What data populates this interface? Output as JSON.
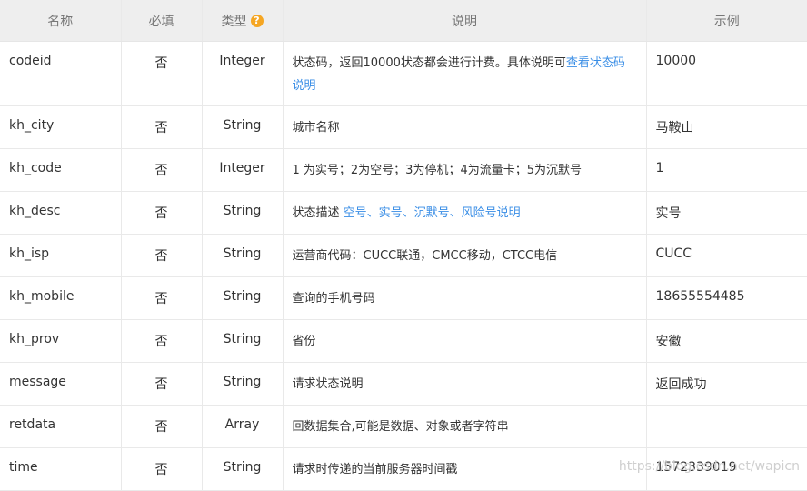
{
  "header": {
    "name": "名称",
    "required": "必填",
    "type": "类型",
    "help_icon": "?",
    "description": "说明",
    "example": "示例"
  },
  "rows": [
    {
      "name": "codeid",
      "required": "否",
      "type": "Integer",
      "desc_text": "状态码，返回10000状态都会进行计费。具体说明可",
      "desc_link": "查看状态码说明",
      "example": "10000"
    },
    {
      "name": "kh_city",
      "required": "否",
      "type": "String",
      "desc_text": "城市名称",
      "desc_link": "",
      "example": "马鞍山"
    },
    {
      "name": "kh_code",
      "required": "否",
      "type": "Integer",
      "desc_text": "1 为实号；2为空号；3为停机；4为流量卡；5为沉默号",
      "desc_link": "",
      "example": "1"
    },
    {
      "name": "kh_desc",
      "required": "否",
      "type": "String",
      "desc_text": "状态描述 ",
      "desc_link": "空号、实号、沉默号、风险号说明",
      "example": "实号"
    },
    {
      "name": "kh_isp",
      "required": "否",
      "type": "String",
      "desc_text": "运营商代码：CUCC联通，CMCC移动，CTCC电信",
      "desc_link": "",
      "example": "CUCC"
    },
    {
      "name": "kh_mobile",
      "required": "否",
      "type": "String",
      "desc_text": "查询的手机号码",
      "desc_link": "",
      "example": "18655554485"
    },
    {
      "name": "kh_prov",
      "required": "否",
      "type": "String",
      "desc_text": "省份",
      "desc_link": "",
      "example": "安徽"
    },
    {
      "name": "message",
      "required": "否",
      "type": "String",
      "desc_text": "请求状态说明",
      "desc_link": "",
      "example": "返回成功"
    },
    {
      "name": "retdata",
      "required": "否",
      "type": "Array",
      "desc_text": "回数据集合,可能是数据、对象或者字符串",
      "desc_link": "",
      "example": ""
    },
    {
      "name": "time",
      "required": "否",
      "type": "String",
      "desc_text": "请求时传递的当前服务器时间戳",
      "desc_link": "",
      "example": "1572339019"
    }
  ],
  "watermark": "https://blog.csdn.net/wapicn",
  "colors": {
    "link": "#3a8ee6",
    "help_icon": "#f5a623",
    "header_bg": "#eeeeee"
  }
}
